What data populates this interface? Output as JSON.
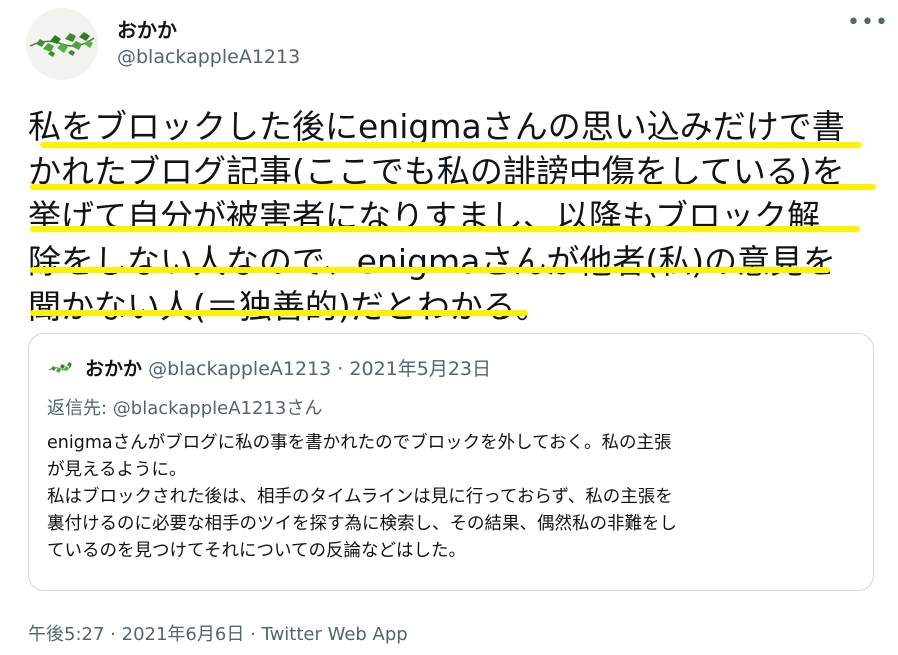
{
  "author": {
    "name": "おかか",
    "handle": "@blackappleA1213"
  },
  "more_icon": "more-horizontal-icon",
  "tweet": {
    "lines": [
      "私をブロックした後にenigmaさんの思い込みだけで書",
      "かれたブログ記事(ここでも私の誹謗中傷をしている)を",
      "挙げて自分が被害者になりすまし、以降もブロック解",
      "除をしない人なので、enigmaさんが他者(私)の意見を",
      "聞かない人(＝独善的)だとわかる。"
    ],
    "highlight_color": "#fff200"
  },
  "quote": {
    "name": "おかか",
    "handle": "@blackappleA1213",
    "separator": "·",
    "date": "2021年5月23日",
    "reply_prefix": "返信先: ",
    "reply_handle": "@blackappleA1213さん",
    "lines": [
      "enigmaさんがブログに私の事を書かれたのでブロックを外しておく。私の主張",
      "が見えるように。",
      "私はブロックされた後は、相手のタイムラインは見に行っておらず、私の主張を",
      "裏付けるのに必要な相手のツイを探す為に検索し、その結果、偶然私の非難をし",
      "ているのを見つけてそれについての反論などはした。"
    ]
  },
  "footer": {
    "time": "午後5:27",
    "separator": "·",
    "date": "2021年6月6日",
    "source": "Twitter Web App"
  }
}
